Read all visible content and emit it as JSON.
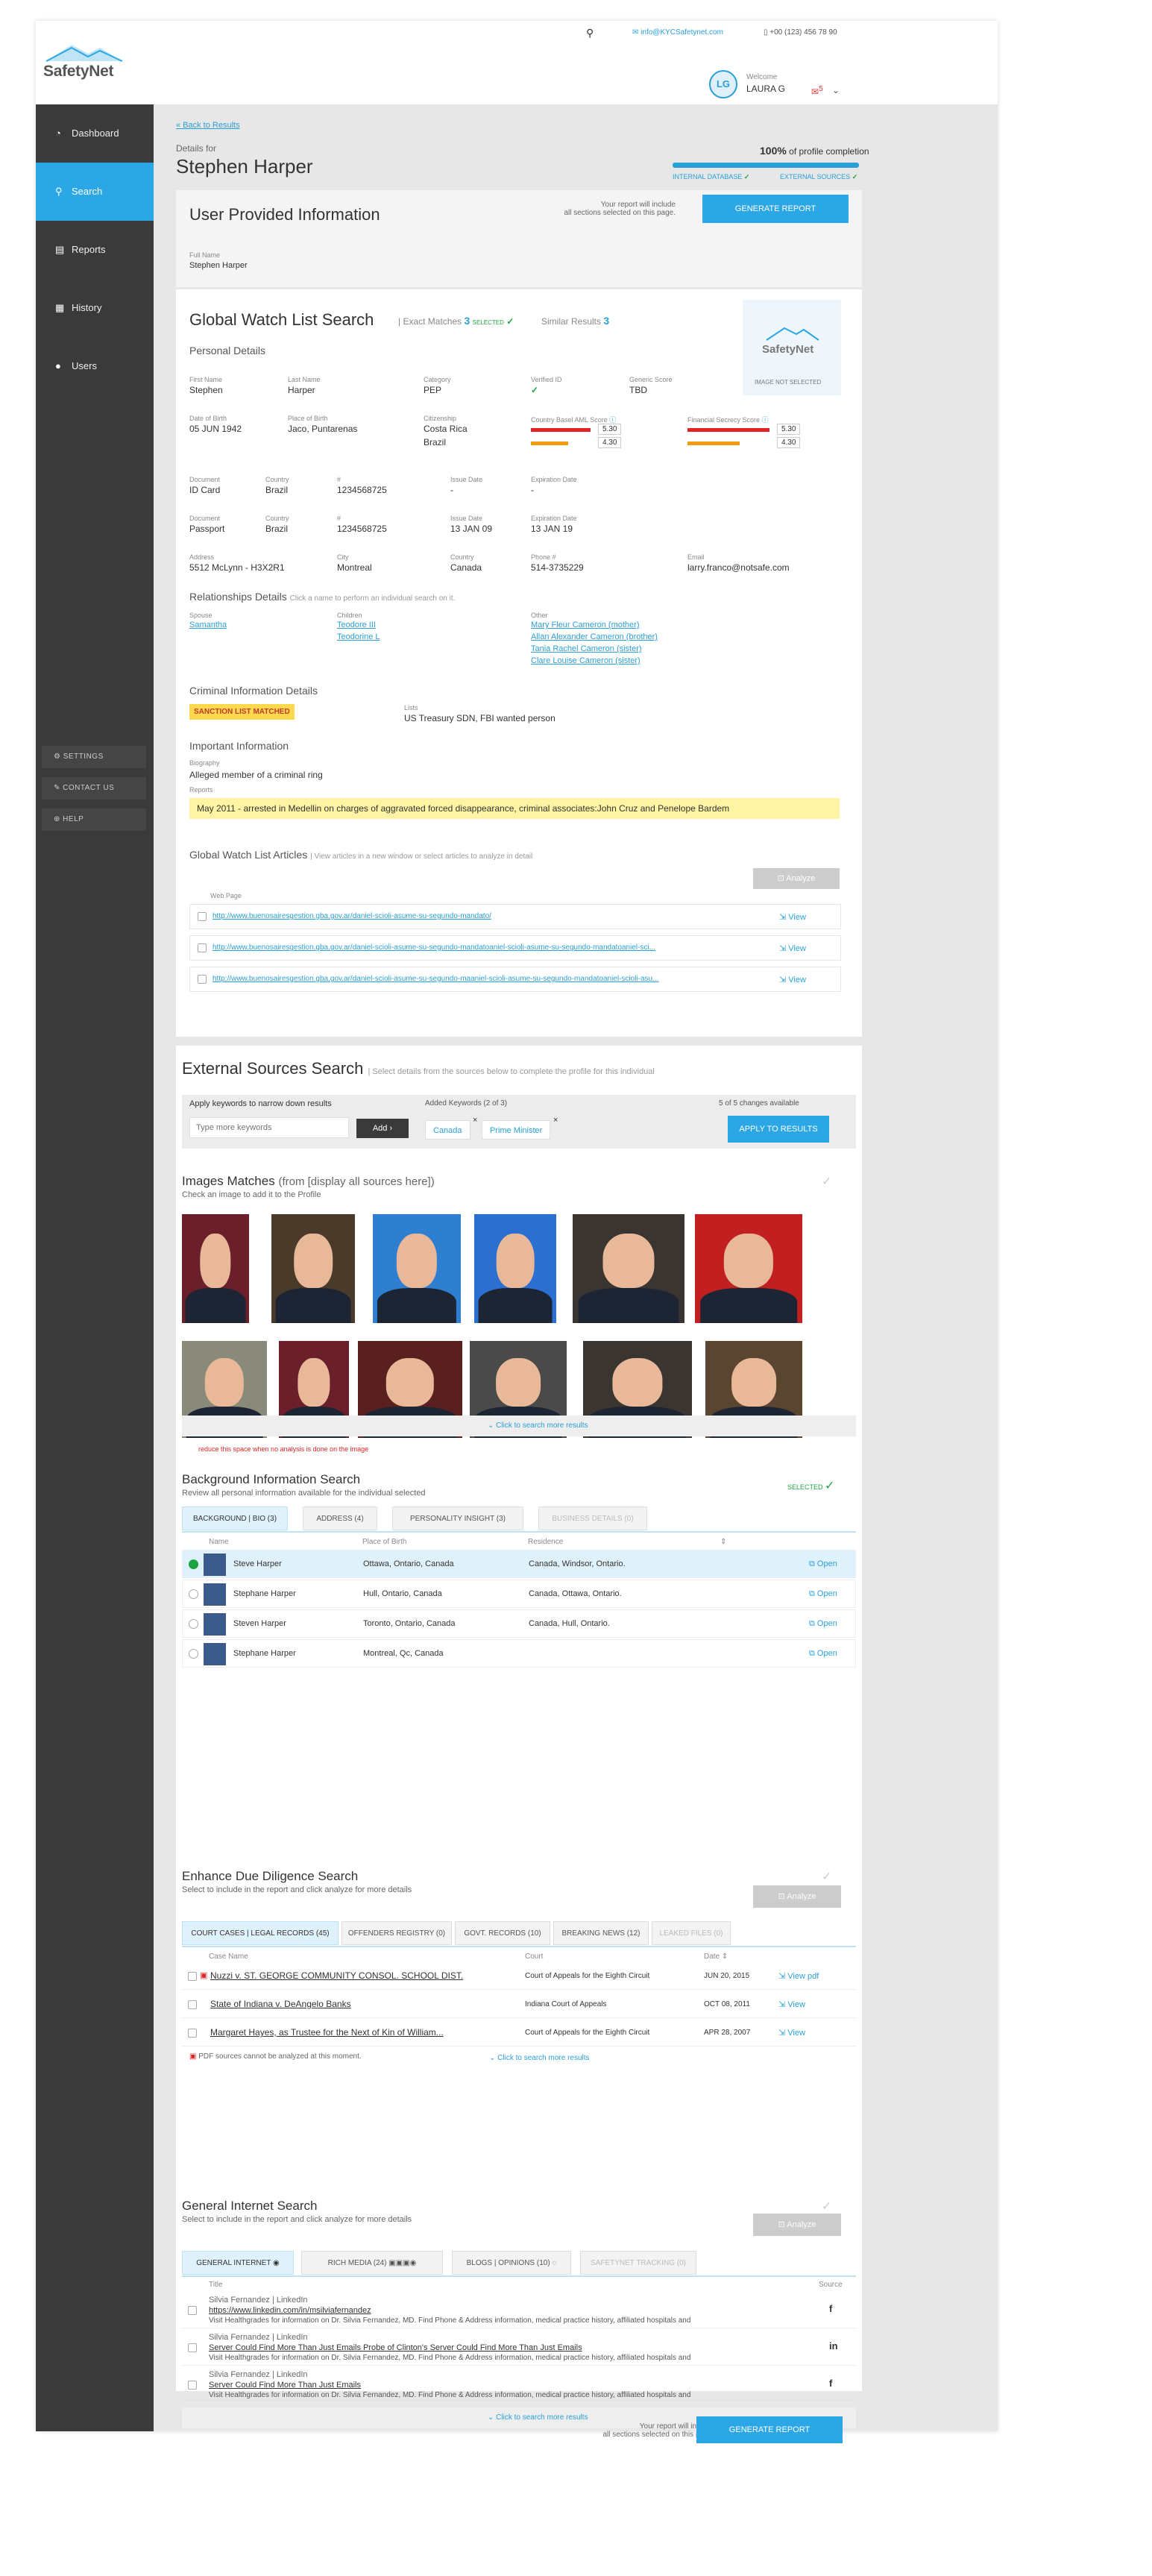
{
  "header": {
    "email": "info@KYCSafetynet.com",
    "phone": "+00 (123) 456 78 90",
    "welcome": "Welcome",
    "user_name": "LAURA G",
    "avatar_initials": "LG",
    "notification_count": "5",
    "logo_text": "SafetyNet"
  },
  "nav": {
    "items": [
      {
        "label": "Dashboard",
        "icon": "speedometer-icon"
      },
      {
        "label": "Search",
        "icon": "search-icon"
      },
      {
        "label": "Reports",
        "icon": "document-icon"
      },
      {
        "label": "History",
        "icon": "calendar-icon"
      },
      {
        "label": "Users",
        "icon": "user-icon"
      }
    ],
    "secondary": [
      {
        "label": "SETTINGS"
      },
      {
        "label": "CONTACT US"
      },
      {
        "label": "HELP"
      }
    ]
  },
  "page": {
    "back_label": "« Back to Results",
    "details_for": "Details for",
    "subject": "Stephen Harper",
    "completion": "100%",
    "completion_suffix": "of profile completion",
    "progress": 1.0,
    "internal_db": "INTERNAL DATABASE",
    "external_sources": "EXTERNAL SOURCES"
  },
  "user_info": {
    "title": "User Provided Information",
    "report_note_1": "Your report will include",
    "report_note_2": "all sections selected on this page.",
    "generate_label": "GENERATE REPORT",
    "full_name_label": "Full Name",
    "full_name": "Stephen Harper"
  },
  "watchlist": {
    "title": "Global Watch List Search",
    "exact_label": "Exact Matches",
    "exact_count": "3",
    "selected_label": "SELECTED",
    "similar_label": "Similar Results",
    "similar_count": "3",
    "image_logo_text": "SafetyNet",
    "image_note": "IMAGE NOT SELECTED",
    "personal_title": "Personal Details",
    "first_name_l": "First Name",
    "first_name": "Stephen",
    "last_name_l": "Last Name",
    "last_name": "Harper",
    "category_l": "Category",
    "category": "PEP",
    "verified_l": "Verified ID",
    "generic_score_l": "Generic Score",
    "generic_score": "TBD",
    "dob_l": "Date of Birth",
    "dob": "05 JUN 1942",
    "pob_l": "Place of Birth",
    "pob": "Jaco, Puntarenas",
    "citizenship_l": "Citizenship",
    "citizenship_1": "Costa Rica",
    "citizenship_2": "Brazil",
    "aml_l": "Country Basel AML Score",
    "aml_1": "5.30",
    "aml_2": "4.30",
    "secrecy_l": "Financial Secrecy Score",
    "secrecy_1": "5.30",
    "secrecy_2": "4.30",
    "doc_rows": [
      {
        "doc_l": "Document",
        "doc": "ID Card",
        "country_l": "Country",
        "country": "Brazil",
        "num_l": "#",
        "num": "1234568725",
        "issue_l": "Issue Date",
        "issue": "-",
        "exp_l": "Expiration Date",
        "exp": "-"
      },
      {
        "doc_l": "Document",
        "doc": "Passport",
        "country_l": "Country",
        "country": "Brazil",
        "num_l": "#",
        "num": "1234568725",
        "issue_l": "Issue Date",
        "issue": "13 JAN 09",
        "exp_l": "Expiration Date",
        "exp": "13 JAN 19"
      }
    ],
    "address_l": "Address",
    "address": "5512 McLynn - H3X2R1",
    "city_l": "City",
    "city": "Montreal",
    "country_l": "Country",
    "country": "Canada",
    "phone_l": "Phone #",
    "phone": "514-3735229",
    "email_l": "Email",
    "email": "larry.franco@notsafe.com",
    "rel_title": "Relationships Details",
    "rel_hint": "Click a name to perform an individual search on it.",
    "spouse_l": "Spouse",
    "spouse": "Samantha",
    "children_l": "Children",
    "children": [
      "Teodore III",
      "Teodorine L"
    ],
    "other_l": "Other",
    "other": [
      "Mary Fleur Cameron (mother)",
      "Allan Alexander Cameron (brother)",
      "Tania Rachel Cameron (sister)",
      "Clare Louise Cameron (sister)"
    ],
    "criminal_title": "Criminal Information Details",
    "sanction_badge": "SANCTION LIST MATCHED",
    "lists_l": "Lists",
    "lists": "US Treasury SDN, FBI wanted person",
    "important_title": "Important Information",
    "bio_l": "Biography",
    "bio": "Alleged member of a criminal ring",
    "reports_l": "Reports",
    "report": "May 2011 - arrested in Medellin on charges of aggravated forced disappearance, criminal associates:John Cruz and Penelope Bardem",
    "articles_title": "Global Watch List Articles",
    "articles_hint": "View articles in a new window or select articles to analyze in detail",
    "analyze_label": "Analyze",
    "webpage_l": "Web Page",
    "view_label": "View",
    "articles": [
      "http://www.buenosairesgestion.gba.gov.ar/daniel-scioli-asume-su-segundo-mandato/",
      "http://www.buenosairesgestion.gba.gov.ar/daniel-scioli-asume-su-segundo-mandatoaniel-scioli-asume-su-segundo-mandatoaniel-sci...",
      "http://www.buenosairesgestion.gba.gov.ar/daniel-scioli-asume-su-segundo-maaniel-scioli-asume-su-segundo-mandatoaniel-scioli-asu..."
    ]
  },
  "external": {
    "title": "External Sources Search",
    "hint": "Select details from the sources below to complete the profile for this individual",
    "kw_label": "Apply keywords to narrow down results",
    "kw_placeholder": "Type more keywords",
    "add_label": "Add ›",
    "added_label": "Added Keywords (2 of 3)",
    "changes": "5 of 5 changes available",
    "keywords": [
      "Canada",
      "Prime Minister"
    ],
    "apply_label": "APPLY TO RESULTS"
  },
  "images": {
    "title": "Images Matches",
    "title_suffix": "(from [display all sources here])",
    "hint": "Check an image to add it to the Profile",
    "more_label": "Click to search more results",
    "note": "reduce  this space when no analysis is done on the image"
  },
  "background": {
    "title": "Background Information Search",
    "hint": "Review all personal information available for the individual selected",
    "selected_label": "SELECTED",
    "tabs": [
      "BACKGROUND | BIO (3)",
      "ADDRESS (4)",
      "PERSONALITY INSIGHT (3)",
      "BUSINESS DETAILS (0)"
    ],
    "cols": [
      "Name",
      "Place of Birth",
      "Residence"
    ],
    "open_label": "Open",
    "rows": [
      {
        "name": "Steve Harper",
        "pob": "Ottawa, Ontario, Canada",
        "res": "Canada, Windsor, Ontario."
      },
      {
        "name": "Stephane Harper",
        "pob": "Hull, Ontario, Canada",
        "res": "Canada, Ottawa, Ontario."
      },
      {
        "name": "Steven Harper",
        "pob": "Toronto, Ontario, Canada",
        "res": "Canada, Hull, Ontario."
      },
      {
        "name": "Stephane Harper",
        "pob": "Montreal, Qc, Canada",
        "res": ""
      }
    ]
  },
  "due": {
    "title": "Enhance Due Diligence  Search",
    "hint": "Select to include in the report and click  analyze for more details",
    "analyze_label": "Analyze",
    "tabs": [
      "COURT CASES | LEGAL RECORDS (45)",
      "OFFENDERS REGISTRY (0)",
      "GOVT. RECORDS (10)",
      "BREAKING NEWS (12)",
      "LEAKED FILES (0)"
    ],
    "cols": [
      "Case Name",
      "Court",
      "Date"
    ],
    "rows": [
      {
        "name": "Nuzzi v. ST. GEORGE COMMUNITY CONSOL. SCHOOL DIST.",
        "court": "Court of Appeals for the Eighth Circuit",
        "date": "JUN 20, 2015",
        "view": "View pdf"
      },
      {
        "name": "State of Indiana v. DeAngelo Banks",
        "court": "Indiana Court of Appeals",
        "date": "OCT 08, 2011",
        "view": "View"
      },
      {
        "name": "Margaret Hayes, as Trustee for the Next of Kin of William...",
        "court": "Court of Appeals for the Eighth Circuit",
        "date": "APR 28, 2007",
        "view": "View"
      }
    ],
    "pdf_note": "PDF sources cannot be analyzed at this moment.",
    "more_label": "Click to search more results"
  },
  "internet": {
    "title": "General Internet  Search",
    "hint": "Select to include in the report and click  analyze for more details",
    "analyze_label": "Analyze",
    "tabs": [
      "GENERAL INTERNET",
      "RICH MEDIA (24)",
      "BLOGS | OPINIONS  (10)",
      "SAFETYNET TRACKING (0)"
    ],
    "cols": [
      "Title",
      "Source"
    ],
    "rows": [
      {
        "title": "Silvia Fernandez | LinkedIn",
        "link": "https://www.linkedin.com/in/msilviafernandez",
        "desc": "Visit Healthgrades for information on Dr. Silvia Fernandez, MD. Find Phone & Address information, medical practice history, affiliated hospitals and",
        "source": "f"
      },
      {
        "title": "Silvia Fernandez | LinkedIn",
        "link": "Server Could Find More Than Just Emails Probe of Clinton's Server Could Find More Than Just Emails",
        "desc": "Visit Healthgrades for information on Dr. Silvia Fernandez, MD. Find Phone & Address information, medical practice history, affiliated hospitals and",
        "source": "in"
      },
      {
        "title": "Silvia Fernandez | LinkedIn",
        "link": "Server Could Find More Than Just Emails",
        "desc": "Visit Healthgrades for information on Dr. Silvia Fernandez, MD. Find Phone & Address information, medical practice history, affiliated hospitals and",
        "source": "f"
      }
    ],
    "more_label": "Click to search more results"
  },
  "footer": {
    "note_1": "Your report will include",
    "note_2": "all sections selected on this page.",
    "generate_label": "GENERATE REPORT"
  },
  "colors": {
    "accent": "#2ba7e5",
    "sidebar": "#3a3a3a",
    "sanction": "#ffd94d",
    "report_highlight": "#fff4a3",
    "success": "#1ea341",
    "danger": "#e02424"
  }
}
